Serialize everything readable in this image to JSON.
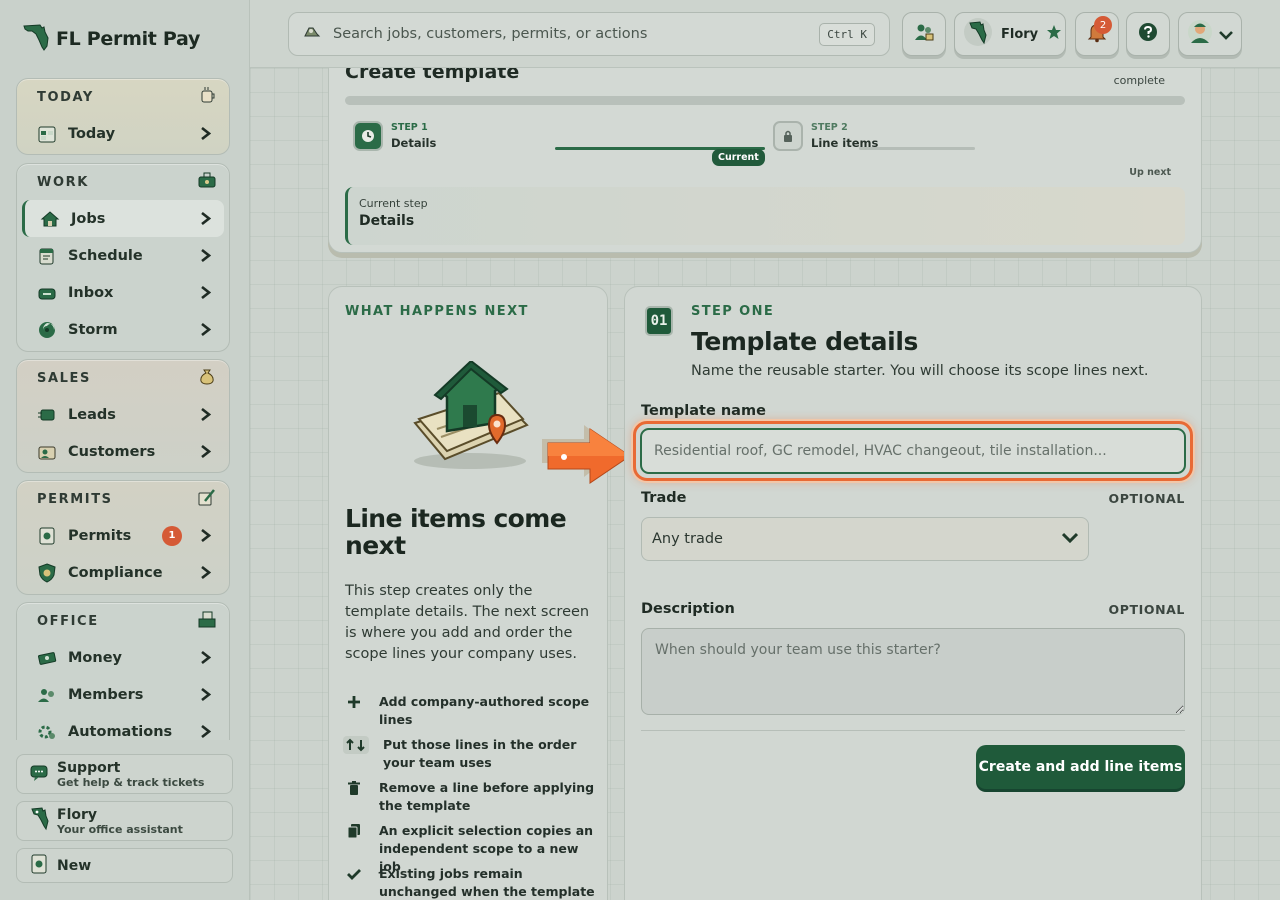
{
  "brand": {
    "title": "FL Permit Pay"
  },
  "sidebar": {
    "groups": [
      {
        "title": "TODAY",
        "items": [
          {
            "label": "Today",
            "icon": "today-icon"
          }
        ]
      },
      {
        "title": "WORK",
        "items": [
          {
            "label": "Jobs",
            "icon": "jobs-icon",
            "active": true
          },
          {
            "label": "Schedule",
            "icon": "schedule-icon"
          },
          {
            "label": "Inbox",
            "icon": "inbox-icon"
          },
          {
            "label": "Storm",
            "icon": "storm-icon"
          }
        ]
      },
      {
        "title": "SALES",
        "items": [
          {
            "label": "Leads",
            "icon": "leads-icon"
          },
          {
            "label": "Customers",
            "icon": "customers-icon"
          }
        ]
      },
      {
        "title": "PERMITS",
        "items": [
          {
            "label": "Permits",
            "icon": "permits-icon",
            "badge": "1"
          },
          {
            "label": "Compliance",
            "icon": "compliance-icon"
          }
        ]
      },
      {
        "title": "OFFICE",
        "items": [
          {
            "label": "Money",
            "icon": "money-icon"
          },
          {
            "label": "Members",
            "icon": "members-icon"
          },
          {
            "label": "Automations",
            "icon": "automations-icon"
          }
        ]
      }
    ],
    "footer": {
      "support": {
        "title": "Support",
        "subtitle": "Get help & track tickets"
      },
      "assistant": {
        "title": "Flory",
        "subtitle": "Your office assistant"
      },
      "new": {
        "title": "New"
      }
    }
  },
  "topbar": {
    "search_placeholder": "Search jobs, customers, permits, or actions",
    "shortcut": "Ctrl K",
    "assistant_name": "Flory",
    "notification_count": "2"
  },
  "progress": {
    "title": "Create template",
    "complete_label": "complete",
    "fill_fraction": 0.0,
    "step1": {
      "number": "STEP 1",
      "name": "Details"
    },
    "step2": {
      "number": "STEP 2",
      "name": "Line items"
    },
    "current_pill": "Current",
    "up_next": "Up next",
    "current_step_label": "Current step",
    "current_step_value": "Details"
  },
  "next_panel": {
    "eyebrow": "WHAT HAPPENS NEXT",
    "heading": "Line items come next",
    "body": "This step creates only the template details. The next screen is where you add and order the scope lines your company uses.",
    "bullets": [
      {
        "icon": "plus-icon",
        "text": "Add company-authored scope lines"
      },
      {
        "icon": "reorder-icon",
        "text": "Put those lines in the order your team uses"
      },
      {
        "icon": "trash-icon",
        "text": "Remove a line before applying the template"
      },
      {
        "icon": "copy-icon",
        "text": "An explicit selection copies an independent scope to a new job"
      },
      {
        "icon": "check-icon",
        "text": "Existing jobs remain unchanged when the template is edited"
      }
    ]
  },
  "form": {
    "eyebrow": "STEP ONE",
    "step_badge": "01",
    "title": "Template details",
    "subtitle": "Name the reusable starter. You will choose its scope lines next.",
    "name_label": "Template name",
    "name_placeholder": "Residential roof, GC remodel, HVAC changeout, tile installation...",
    "trade_label": "Trade",
    "trade_optional": "OPTIONAL",
    "trade_value": "Any trade",
    "description_label": "Description",
    "description_optional": "OPTIONAL",
    "description_placeholder": "When should your team use this starter?",
    "submit_label": "Create and add line items"
  },
  "colors": {
    "brand_green": "#2b6b47",
    "dark_green": "#1f5a3a",
    "highlight_orange": "#e86a35",
    "badge_red": "#d55a36"
  }
}
